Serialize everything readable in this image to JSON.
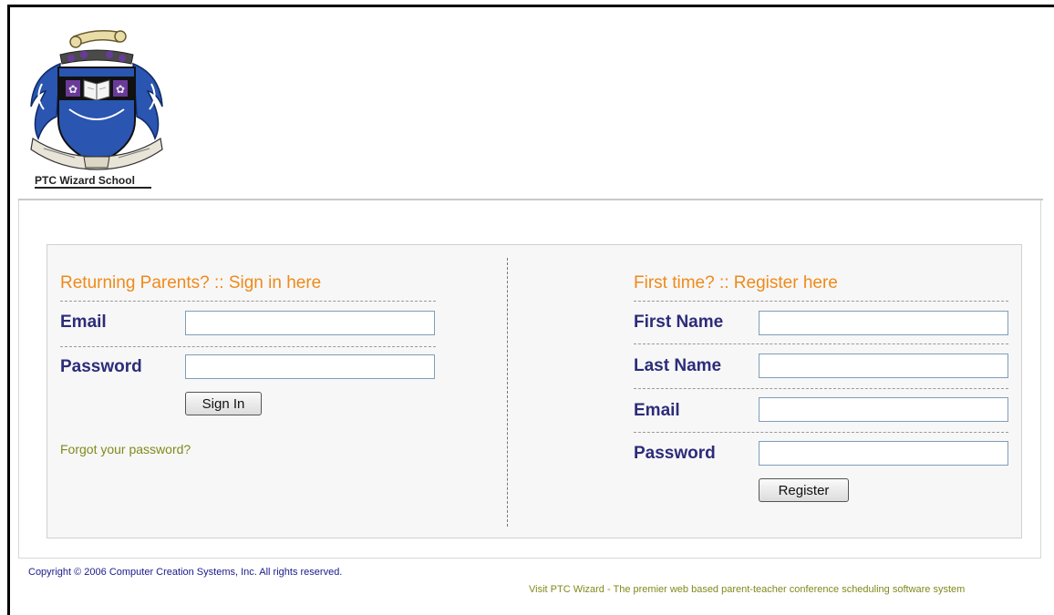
{
  "school": {
    "name": "PTC Wizard School",
    "crest_ribbon": ""
  },
  "signin": {
    "heading": "Returning Parents? :: Sign in here",
    "email_label": "Email",
    "password_label": "Password",
    "email_value": "",
    "password_value": "",
    "button": "Sign In",
    "forgot": "Forgot your password?"
  },
  "register": {
    "heading": "First time? :: Register here",
    "first_name_label": "First Name",
    "last_name_label": "Last Name",
    "email_label": "Email",
    "password_label": "Password",
    "first_name_value": "",
    "last_name_value": "",
    "email_value": "",
    "password_value": "",
    "button": "Register"
  },
  "footer": {
    "copyright": "Copyright © 2006 Computer Creation Systems, Inc. All rights reserved.",
    "promo": "Visit PTC Wizard - The premier web based parent-teacher conference scheduling software system"
  },
  "colors": {
    "heading": "#ee8a1a",
    "label": "#2c2c7a",
    "link": "#7f8a1a",
    "copyright": "#1a1a8c",
    "crest_blue": "#2a55b0"
  }
}
